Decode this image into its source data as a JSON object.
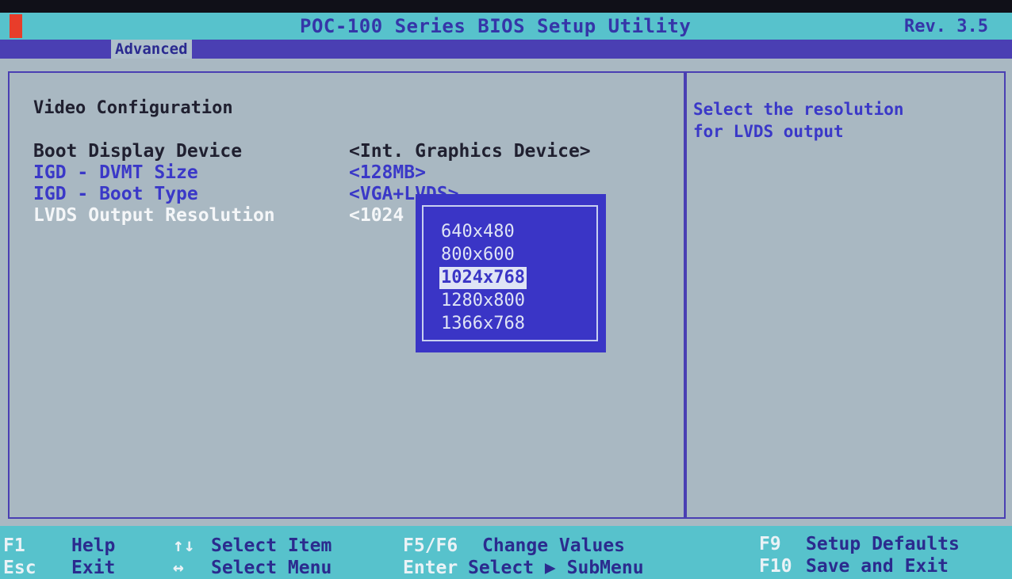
{
  "title_bar": {
    "title": "POC-100 Series BIOS Setup Utility",
    "revision": "Rev. 3.5"
  },
  "menu": {
    "active_tab": "Advanced"
  },
  "main": {
    "section_title": "Video Configuration",
    "settings": [
      {
        "label": "Boot Display Device",
        "value": "<Int. Graphics Device>"
      },
      {
        "label": "IGD - DVMT Size",
        "value": "<128MB>"
      },
      {
        "label": "IGD - Boot Type",
        "value": "<VGA+LVDS>"
      },
      {
        "label": "LVDS Output Resolution",
        "value": "<1024"
      }
    ]
  },
  "help": {
    "text": "Select the resolution\nfor LVDS output"
  },
  "popup": {
    "options": [
      "640x480",
      "800x600",
      "1024x768",
      "1280x800",
      "1366x768"
    ],
    "selected": "1024x768"
  },
  "footer": {
    "items": [
      {
        "key": "F1",
        "desc": "Help"
      },
      {
        "key": "Esc",
        "desc": "Exit"
      },
      {
        "key": "↑↓",
        "desc": "Select Item"
      },
      {
        "key": "↔",
        "desc": "Select Menu"
      },
      {
        "key": "F5/F6",
        "desc": "Change Values"
      },
      {
        "key": "Enter",
        "desc": "Select ▶ SubMenu"
      },
      {
        "key": "F9",
        "desc": "Setup Defaults"
      },
      {
        "key": "F10",
        "desc": "Save and Exit"
      }
    ]
  },
  "colors": {
    "title_bar": "#57c2cc",
    "menu_bar": "#4a3fb3",
    "body": "#a9b8c2",
    "popup": "#3a35c6",
    "accent_blue": "#3a38c8",
    "marker_red": "#e83d2a"
  }
}
